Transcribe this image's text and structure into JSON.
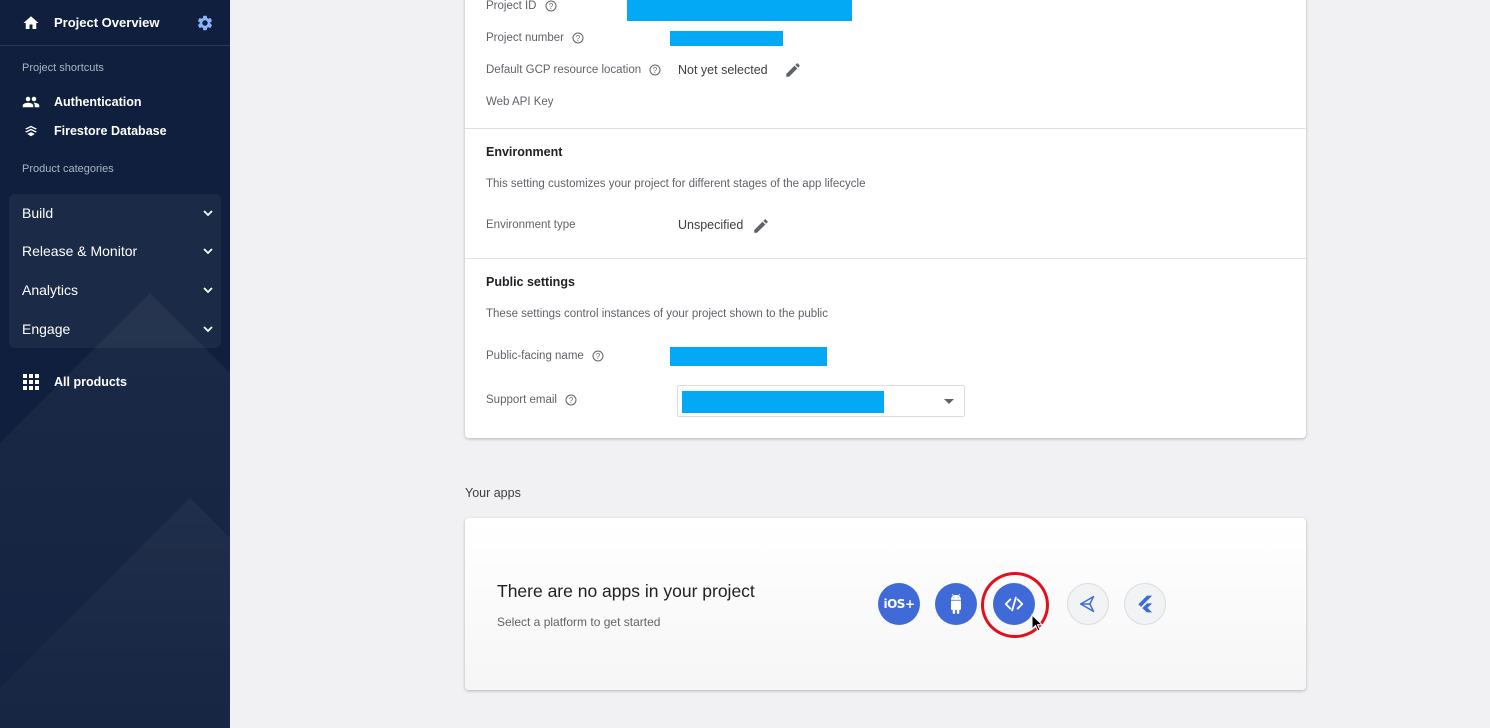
{
  "sidebar": {
    "title": "Project Overview",
    "shortcuts_label": "Project shortcuts",
    "shortcuts": [
      {
        "label": "Authentication",
        "icon": "people-icon"
      },
      {
        "label": "Firestore Database",
        "icon": "firestore-icon"
      }
    ],
    "categories_label": "Product categories",
    "categories": [
      {
        "label": "Build"
      },
      {
        "label": "Release & Monitor"
      },
      {
        "label": "Analytics"
      },
      {
        "label": "Engage"
      }
    ],
    "all_products": "All products"
  },
  "project": {
    "project_id_label": "Project ID",
    "project_number_label": "Project number",
    "gcp_location_label": "Default GCP resource location",
    "gcp_location_value": "Not yet selected",
    "web_api_key_label": "Web API Key"
  },
  "environment": {
    "title": "Environment",
    "description": "This setting customizes your project for different stages of the app lifecycle",
    "type_label": "Environment type",
    "type_value": "Unspecified"
  },
  "public_settings": {
    "title": "Public settings",
    "description": "These settings control instances of your project shown to the public",
    "public_name_label": "Public-facing name",
    "support_email_label": "Support email"
  },
  "your_apps": {
    "heading": "Your apps",
    "empty_title": "There are no apps in your project",
    "empty_subtitle": "Select a platform to get started",
    "platforms": [
      {
        "label": "iOS+",
        "icon": "ios-icon"
      },
      {
        "label": "",
        "icon": "android-icon"
      },
      {
        "label": "",
        "icon": "web-code-icon"
      },
      {
        "label": "",
        "icon": "unity-icon"
      },
      {
        "label": "",
        "icon": "flutter-icon"
      }
    ]
  },
  "colors": {
    "sidebar_bg": "#0f1f3d",
    "accent_blue": "#3f6ad8",
    "redaction": "#03a9f4",
    "highlight_red": "#e2101b"
  }
}
